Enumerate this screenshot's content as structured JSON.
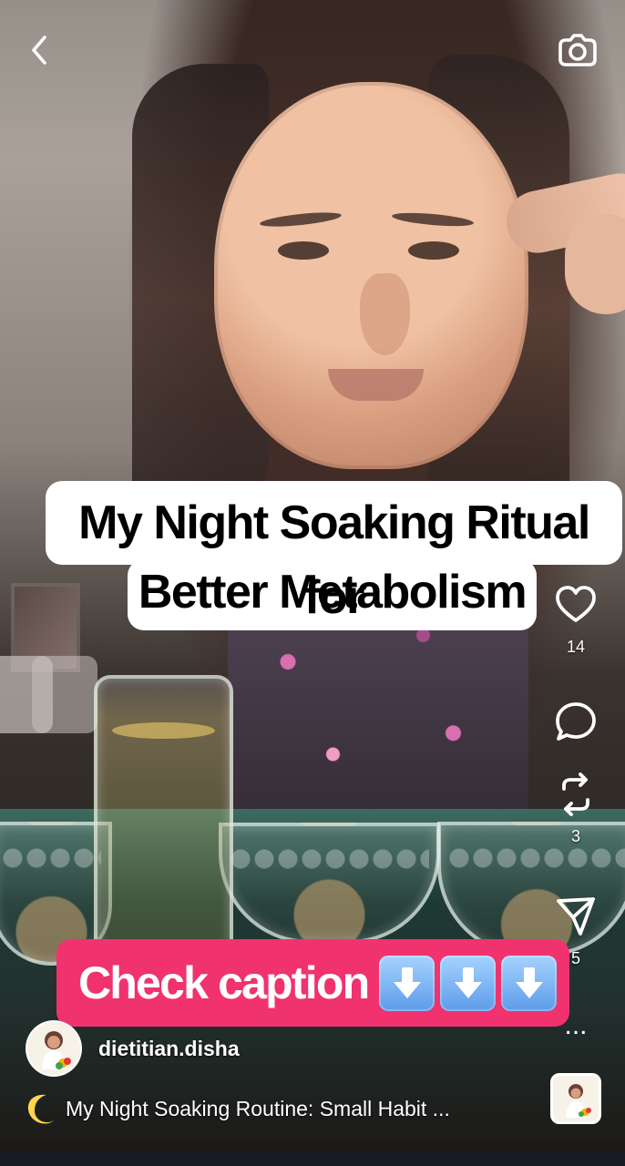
{
  "headline": {
    "line1": "My Night Soaking Ritual for",
    "line2": "Better Metabolism"
  },
  "caption_button": {
    "text": "Check caption",
    "arrow_icons": [
      "down-arrow-icon",
      "down-arrow-icon",
      "down-arrow-icon"
    ]
  },
  "actions": {
    "likes": "14",
    "reposts": "3",
    "shares": "5",
    "more": "..."
  },
  "profile": {
    "username": "dietitian.disha"
  },
  "caption": {
    "preview": "My Night Soaking Routine: Small Habit ..."
  },
  "icons": {
    "top_left": "back-icon",
    "top_right": "camera-icon",
    "like": "heart-icon",
    "comment": "comment-icon",
    "repost": "repost-icon",
    "share": "send-icon",
    "caption_prefix": "moon-icon"
  },
  "colors": {
    "caption_pill": "#f0326f",
    "headline_bg": "#ffffff",
    "arrow_badge_top": "#a6d3ff",
    "arrow_badge_bottom": "#5d9ce9"
  }
}
